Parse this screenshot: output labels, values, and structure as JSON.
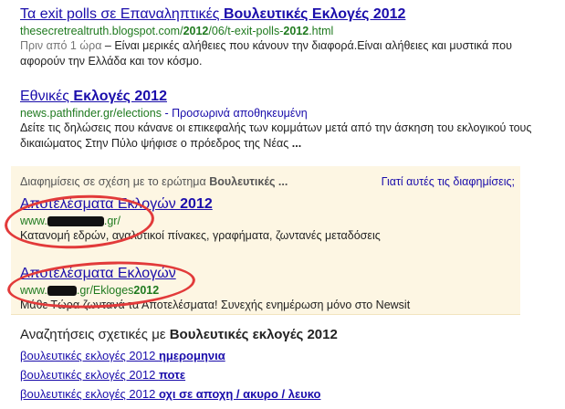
{
  "results": [
    {
      "title_pre": "Τα exit polls σε Επαναληπτικές ",
      "title_bold": "Βουλευτικές Εκλογές 2012",
      "url_a": "thesecretrealtruth.blogspot.com/",
      "url_b": "2012",
      "url_c": "/06/t-exit-polls-",
      "url_d": "2012",
      "url_e": ".html",
      "time": "Πριν από 1 ώρα",
      "desc": " – Είναι μερικές αλήθειες που κάνουν την διαφορά.Είναι αλήθειες και μυστικά που αφορούν την Ελλάδα και τον κόσμο."
    },
    {
      "title_pre": "Εθνικές ",
      "title_bold": "Εκλογές 2012",
      "url": "news.pathfinder.gr/elections",
      "cached": " - Προσωρινά αποθηκευμένη",
      "desc": "Δείτε τις δηλώσεις που κάνανε οι επικεφαλής των κομμάτων μετά από την άσκηση του εκλογικού τους δικαιώματος Στην Πύλο ψήφισε ο πρόεδρος της Νέας ",
      "ellipsis": "..."
    }
  ],
  "ads": {
    "header_pre": "Διαφημίσεις σε σχέση με το ερώτημα ",
    "header_bold": "Βουλευτικές ...",
    "why": "Γιατί αυτές τις διαφημίσεις;",
    "items": [
      {
        "title_pre": "Αποτελέσματα Εκλογών ",
        "title_bold": "2012",
        "url_pre": "www.",
        "url_post": ".gr/",
        "desc": "Κατανομή εδρών, αναλυτικοί πίνακες, γραφήματα, ζωντανές μεταδόσεις"
      },
      {
        "title_pre": "Αποτελέσματα Εκλογών",
        "title_bold": "",
        "url_pre": "www.",
        "url_post": ".gr/Ekloges",
        "url_bold": "2012",
        "desc": "Μάθε Τώρα ζωντανά τα Αποτελέσματα! Συνεχής ενημέρωση μόνο στο Newsit"
      }
    ]
  },
  "related": {
    "head_pre": "Αναζητήσεις σχετικές με ",
    "head_bold": "Βουλευτικές εκλογές 2012",
    "items": [
      {
        "pre": "βουλευτικές εκλογές 2012 ",
        "bold": "ημερομηνια"
      },
      {
        "pre": "βουλευτικές εκλογές 2012 ",
        "bold": "ποτε"
      },
      {
        "pre": "βουλευτικές εκλογές 2012 ",
        "bold": "οχι σε αποχη / ακυρο / λευκο"
      }
    ]
  },
  "colors": {
    "link": "#1a0dab",
    "url": "#1f7a1f",
    "annotation": "#e23a3a",
    "ad_bg": "#fdf6e3"
  }
}
